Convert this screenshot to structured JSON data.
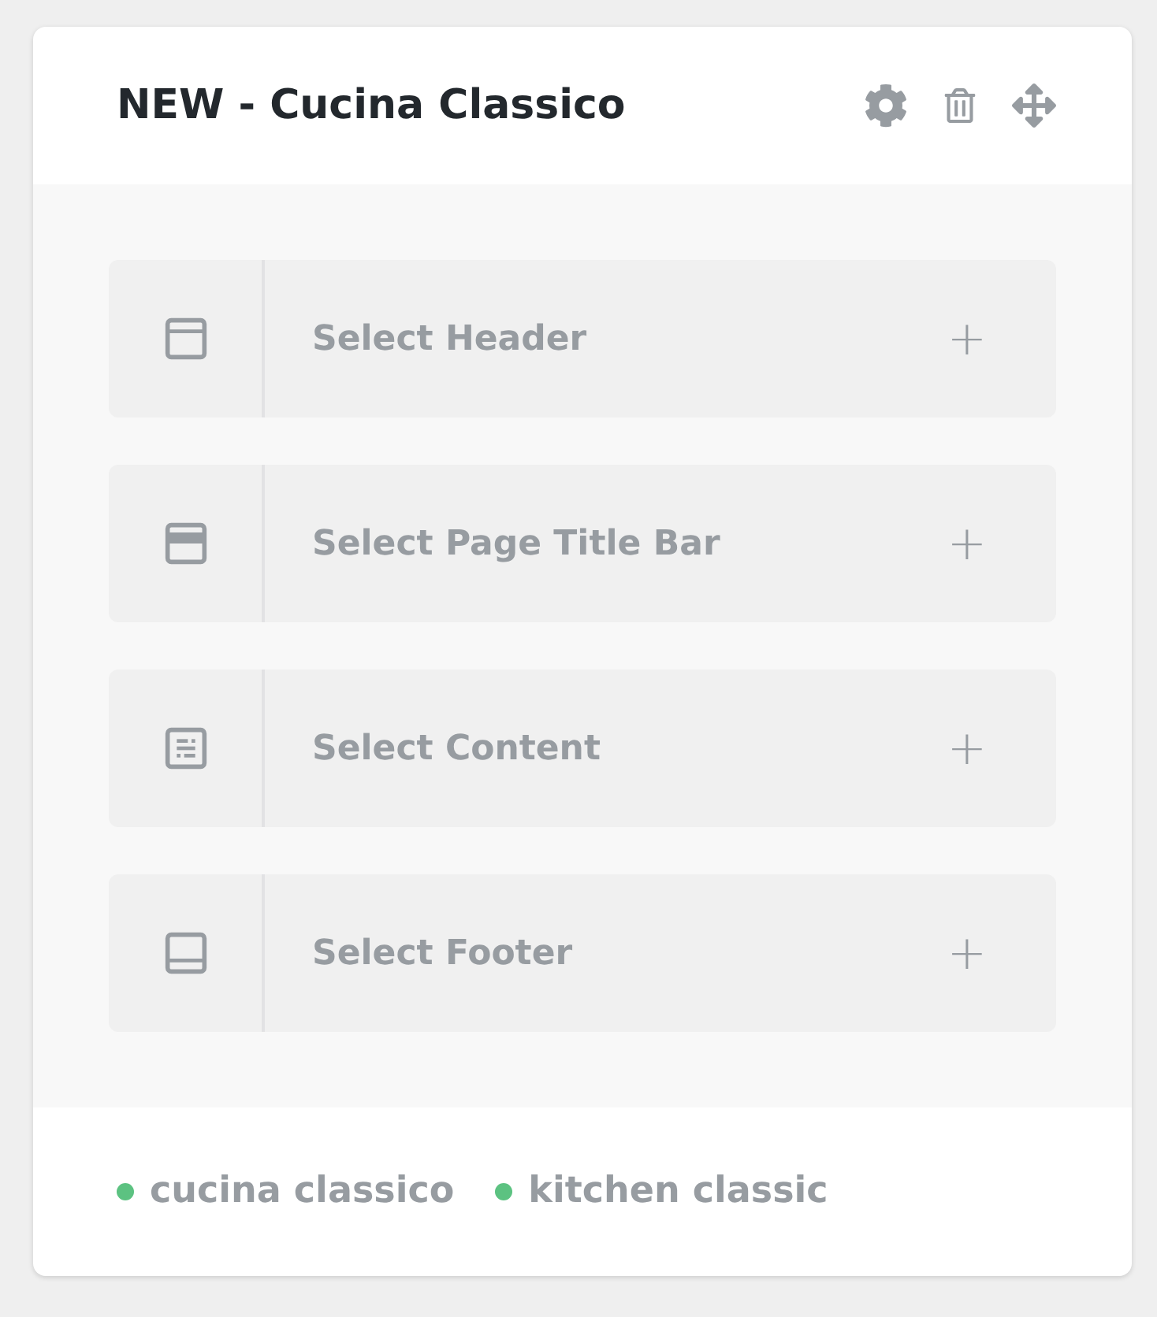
{
  "card": {
    "title": "NEW - Cucina Classico"
  },
  "sections": [
    {
      "kind": "header",
      "label": "Select Header",
      "action": "+"
    },
    {
      "kind": "title_bar",
      "label": "Select Page Title Bar",
      "action": "+"
    },
    {
      "kind": "content",
      "label": "Select Content",
      "action": "+"
    },
    {
      "kind": "footer",
      "label": "Select Footer",
      "action": "+"
    }
  ],
  "tags": [
    {
      "label": "cucina classico",
      "color": "#5cc281"
    },
    {
      "label": "kitchen classic",
      "color": "#5cc281"
    }
  ]
}
